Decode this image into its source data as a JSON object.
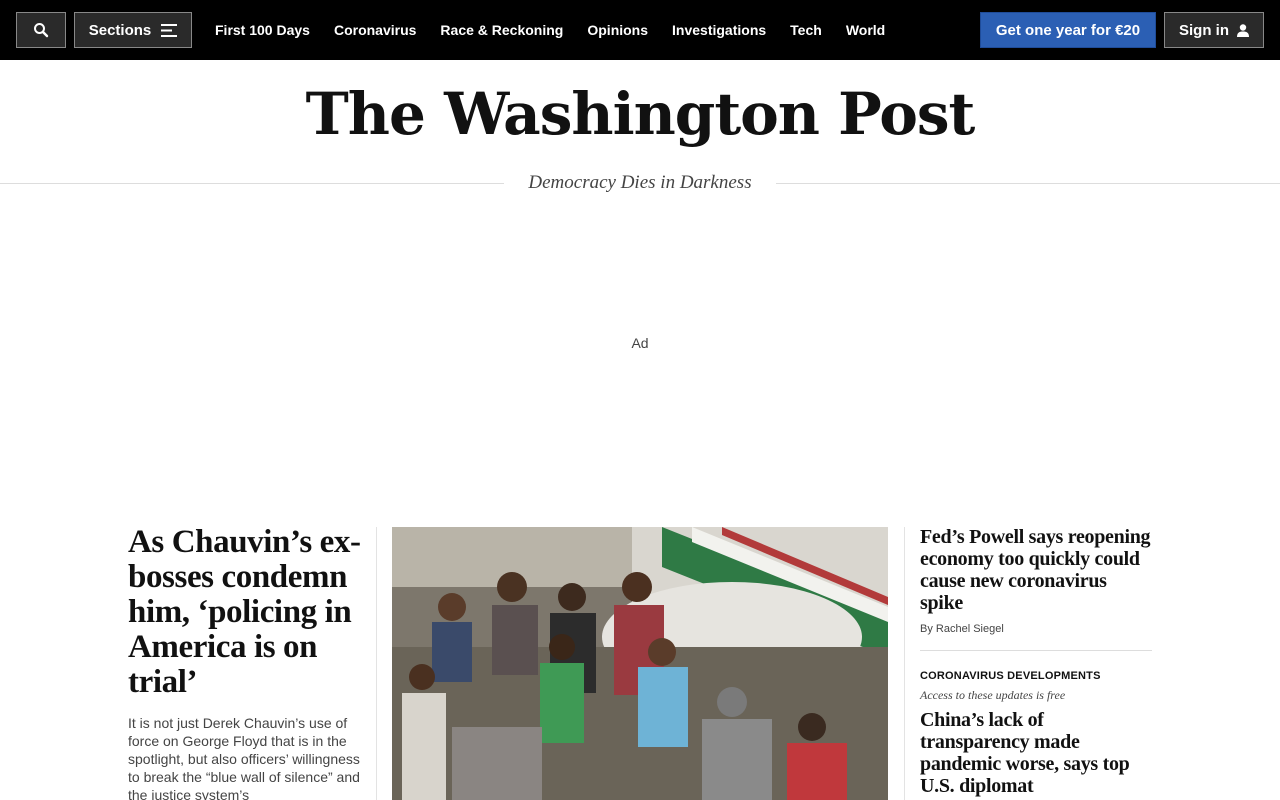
{
  "topnav": {
    "search_icon": "search-icon",
    "sections_label": "Sections",
    "sections_icon": "menu-icon",
    "links": [
      "First 100 Days",
      "Coronavirus",
      "Race & Reckoning",
      "Opinions",
      "Investigations",
      "Tech",
      "World"
    ],
    "subscribe_label": "Get one year for €20",
    "signin_label": "Sign in",
    "signin_icon": "user-icon",
    "colors": {
      "background": "#000000",
      "subscribe": "#2b5fb4"
    }
  },
  "masthead": {
    "logo_text": "The Washington Post",
    "tagline": "Democracy Dies in Darkness"
  },
  "ad": {
    "label": "Ad"
  },
  "lead_story": {
    "headline": "As Chauvin’s ex-bosses condemn him, ‘policing in America is on trial’",
    "blurb": "It is not just Derek Chauvin’s use of force on George Floyd that is in the spotlight, but also officers’ willingness to break the “blue wall of silence” and the justice system’s"
  },
  "photo": {
    "description_icon": "photo-image"
  },
  "right_stories": [
    {
      "headline": "Fed’s Powell says reopening economy too quickly could cause new coronavirus spike",
      "byline": "By Rachel Siegel"
    },
    {
      "kicker": "CORONAVIRUS DEVELOPMENTS",
      "note": "Access to these updates is free",
      "headline": "China’s lack of transparency made pandemic worse, says top U.S. diplomat"
    }
  ]
}
